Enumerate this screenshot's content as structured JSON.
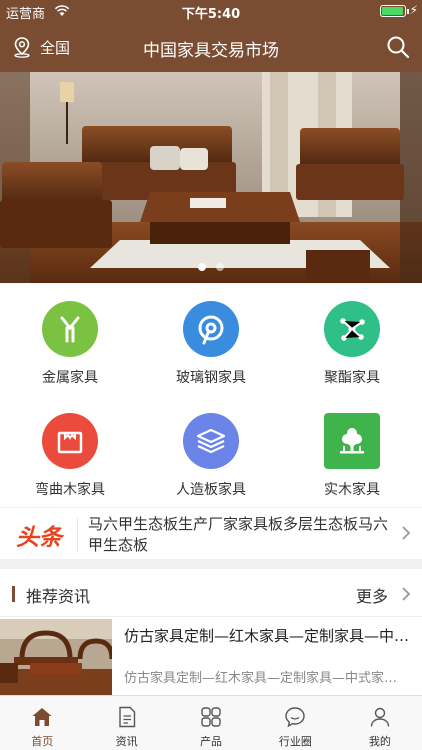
{
  "status_bar": {
    "carrier": "运营商",
    "time": "下午5:40",
    "battery_level": 0.95
  },
  "nav": {
    "location": "全国",
    "title": "中国家具交易市场",
    "search_icon": "search-icon",
    "location_icon": "location-pin-icon"
  },
  "banner": {
    "slide_count": 2,
    "active_slide": 1
  },
  "categories": [
    {
      "label": "金属家具",
      "icon": "metal-frame-icon",
      "color": "#7cc242"
    },
    {
      "label": "玻璃钢家具",
      "icon": "compass-icon",
      "color": "#3a8dde"
    },
    {
      "label": "聚酯家具",
      "icon": "molecule-icon",
      "color": "#2fc08a"
    },
    {
      "label": "弯曲木家具",
      "icon": "bag-icon",
      "color": "#ea4b3c"
    },
    {
      "label": "人造板家具",
      "icon": "layers-icon",
      "color": "#6b84e8"
    },
    {
      "label": "实木家具",
      "icon": "tree-icon",
      "color": "#3fb44c"
    }
  ],
  "headline": {
    "tag": "头条",
    "text": "马六甲生态板生产厂家家具板多层生态板马六甲生态板"
  },
  "recommend": {
    "title": "推荐资讯",
    "more": "更多",
    "items": [
      {
        "title": "仿古家具定制—红木家具—定制家具—中式家具",
        "summary": "仿古家具定制—红木家具—定制家具—中式家具定制"
      }
    ]
  },
  "tabs": [
    {
      "label": "首页",
      "icon": "home-icon",
      "active": true
    },
    {
      "label": "资讯",
      "icon": "document-icon",
      "active": false
    },
    {
      "label": "产品",
      "icon": "grid-icon",
      "active": false
    },
    {
      "label": "行业圈",
      "icon": "chat-bubble-icon",
      "active": false
    },
    {
      "label": "我的",
      "icon": "user-icon",
      "active": false
    }
  ],
  "colors": {
    "brand": "#7a4d33",
    "headline_tag": "#e8441f",
    "battery": "#4cd964"
  }
}
